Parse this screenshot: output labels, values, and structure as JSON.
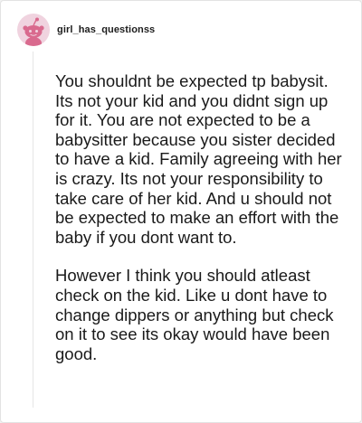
{
  "comment": {
    "username": "girl_has_questionss",
    "avatar_icon": "reddit-snoo-avatar-icon",
    "paragraphs": [
      "You shouldnt be expected tp babysit. Its not your kid and you didnt sign up for it. You are not expected to be a babysitter because you sister decided to have a kid. Family agreeing with her is crazy. Its not your responsibility to take care of her kid. And u should not be expected to make an effort with the baby if you dont want to.",
      "However I think you should atleast check on the kid. Like u dont have to change dippers or anything but check on it to see its okay would have been good."
    ]
  },
  "colors": {
    "avatar_bg": "#f0d3df",
    "avatar_figure": "#d96a8e",
    "text": "#1a1a1a",
    "thread_line": "#e6e6e6"
  }
}
